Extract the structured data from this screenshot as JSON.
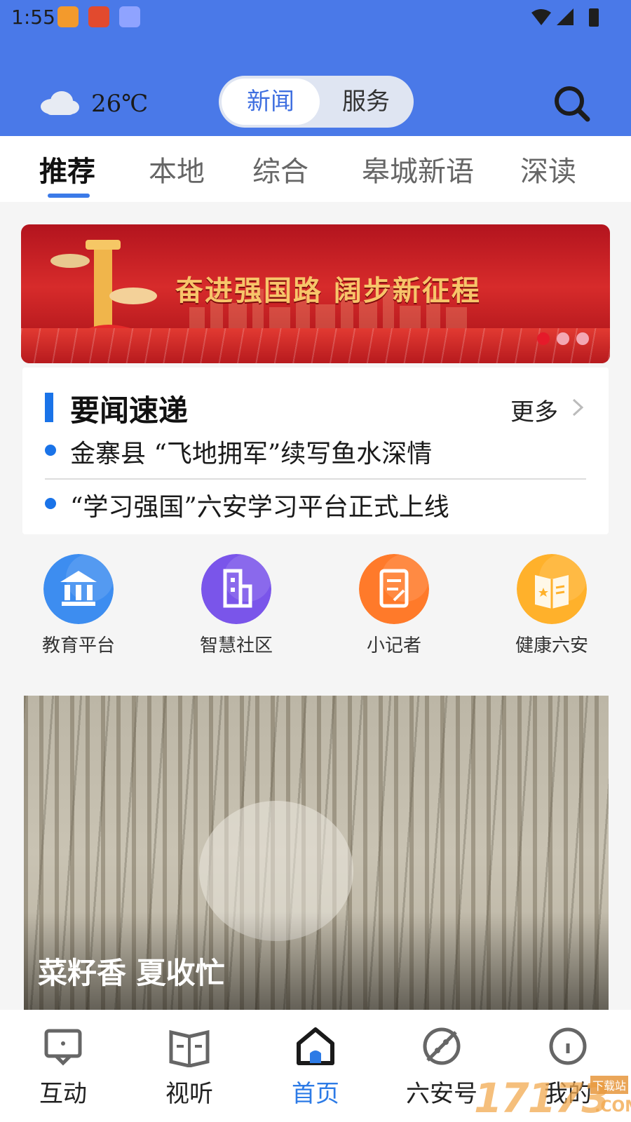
{
  "status_bar": {
    "time": "1:55"
  },
  "header": {
    "weather": {
      "icon": "cloud-icon",
      "temperature": "26℃"
    },
    "segment": {
      "active": "新闻",
      "inactive": "服务"
    },
    "search_icon": "search-icon"
  },
  "tabs": [
    {
      "label": "推荐",
      "active": true
    },
    {
      "label": "本地"
    },
    {
      "label": "综合"
    },
    {
      "label": "皋城新语"
    },
    {
      "label": "深读"
    }
  ],
  "banner": {
    "text": "奋进强国路 阔步新征程",
    "dots": 3,
    "active_dot": 0
  },
  "quick_news": {
    "title": "要闻速递",
    "more": "更多",
    "items": [
      "金寨县 “飞地拥军”续写鱼水深情",
      "“学习强国”六安学习平台正式上线"
    ]
  },
  "services": [
    {
      "label": "教育平台",
      "icon": "bank-icon",
      "color": "#3d8df0"
    },
    {
      "label": "智慧社区",
      "icon": "building-icon",
      "color": "#7a55ea"
    },
    {
      "label": "小记者",
      "icon": "note-edit-icon",
      "color": "#ff7a2a"
    },
    {
      "label": "健康六安",
      "icon": "book-star-icon",
      "color": "#ffb12b"
    }
  ],
  "feature": {
    "caption": "菜籽香 夏收忙"
  },
  "bottom_nav": [
    {
      "label": "互动",
      "icon": "chat-screen-icon"
    },
    {
      "label": "视听",
      "icon": "open-book-icon"
    },
    {
      "label": "首页",
      "icon": "home-icon",
      "active": true
    },
    {
      "label": "六安号",
      "icon": "compass-icon"
    },
    {
      "label": "我的",
      "icon": "user-circle-icon"
    }
  ],
  "watermark": {
    "number": "17173",
    "side": "下载站",
    "suffix": ".COM"
  },
  "colors": {
    "header_blue": "#4a79e8",
    "accent_blue": "#1a73e8",
    "active_nav": "#2d7be6",
    "banner_red": "#c8202a"
  }
}
